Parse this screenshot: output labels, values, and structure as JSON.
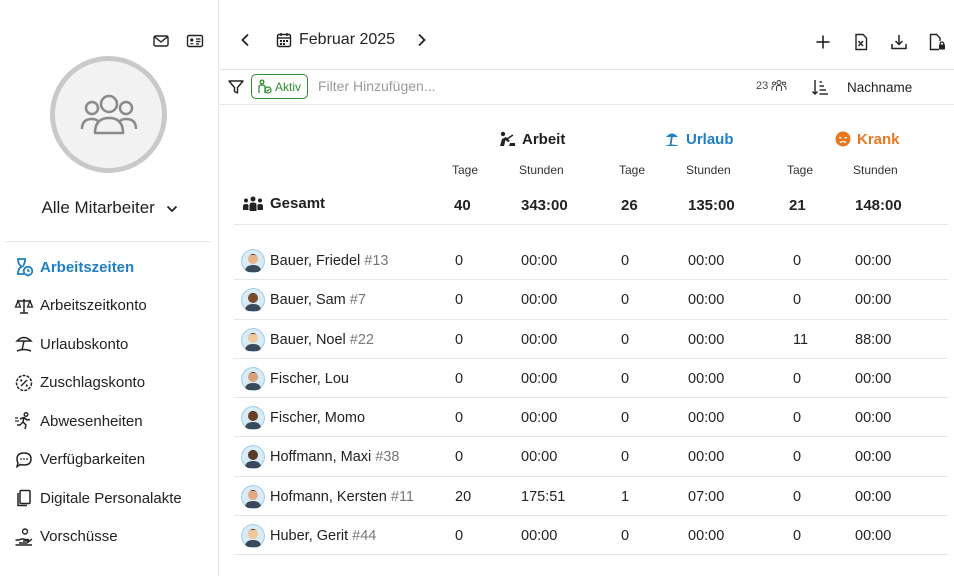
{
  "sidebar": {
    "employee_select": "Alle Mitarbeiter",
    "top_icons": [
      "mail-icon",
      "id-card-icon"
    ],
    "nav": [
      {
        "label": "Arbeitszeiten",
        "icon": "hourglass-clock-icon",
        "active": true
      },
      {
        "label": "Arbeitszeitkonto",
        "icon": "scale-icon",
        "active": false
      },
      {
        "label": "Urlaubskonto",
        "icon": "beach-umbrella-icon",
        "active": false
      },
      {
        "label": "Zuschlagskonto",
        "icon": "percent-badge-icon",
        "active": false
      },
      {
        "label": "Abwesenheiten",
        "icon": "running-person-icon",
        "active": false
      },
      {
        "label": "Verfügbarkeiten",
        "icon": "chat-bubble-icon",
        "active": false
      },
      {
        "label": "Digitale Personalakte",
        "icon": "documents-icon",
        "active": false
      },
      {
        "label": "Vorschüsse",
        "icon": "hand-coins-icon",
        "active": false
      }
    ]
  },
  "header": {
    "month": "Februar 2025",
    "actions": [
      "add-icon",
      "excel-export-icon",
      "download-icon",
      "lock-document-icon"
    ]
  },
  "filter": {
    "chip_label": "Aktiv",
    "placeholder": "Filter Hinzufügen...",
    "count": "23",
    "sort_label": "Nachname"
  },
  "table": {
    "categories": [
      {
        "label": "Arbeit",
        "color": "#222222",
        "icon": "worker-icon"
      },
      {
        "label": "Urlaub",
        "color": "#1f7fc4",
        "icon": "beach-umbrella-icon"
      },
      {
        "label": "Krank",
        "color": "#e87722",
        "icon": "sick-face-icon"
      }
    ],
    "sub_headers": [
      "Tage",
      "Stunden",
      "Tage",
      "Stunden",
      "Tage",
      "Stunden"
    ],
    "total": {
      "label": "Gesamt",
      "values": [
        "40",
        "343:00",
        "26",
        "135:00",
        "21",
        "148:00"
      ]
    },
    "rows": [
      {
        "name": "Bauer, Friedel",
        "num": "#13",
        "values": [
          "0",
          "00:00",
          "0",
          "00:00",
          "0",
          "00:00"
        ],
        "avatar": "#e8b48a"
      },
      {
        "name": "Bauer, Sam",
        "num": "#7",
        "values": [
          "0",
          "00:00",
          "0",
          "00:00",
          "0",
          "00:00"
        ],
        "avatar": "#7a4a2a"
      },
      {
        "name": "Bauer, Noel",
        "num": "#22",
        "values": [
          "0",
          "00:00",
          "0",
          "00:00",
          "11",
          "88:00"
        ],
        "avatar": "#f0c9a0"
      },
      {
        "name": "Fischer, Lou",
        "num": "",
        "values": [
          "0",
          "00:00",
          "0",
          "00:00",
          "0",
          "00:00"
        ],
        "avatar": "#d9a07a"
      },
      {
        "name": "Fischer, Momo",
        "num": "",
        "values": [
          "0",
          "00:00",
          "0",
          "00:00",
          "0",
          "00:00"
        ],
        "avatar": "#6b3f23"
      },
      {
        "name": "Hoffmann, Maxi",
        "num": "#38",
        "values": [
          "0",
          "00:00",
          "0",
          "00:00",
          "0",
          "00:00"
        ],
        "avatar": "#5a3a26"
      },
      {
        "name": "Hofmann, Kersten",
        "num": "#11",
        "values": [
          "20",
          "175:51",
          "1",
          "07:00",
          "0",
          "00:00"
        ],
        "avatar": "#e2ab84"
      },
      {
        "name": "Huber, Gerit",
        "num": "#44",
        "values": [
          "0",
          "00:00",
          "0",
          "00:00",
          "0",
          "00:00"
        ],
        "avatar": "#f2c89a"
      }
    ]
  }
}
